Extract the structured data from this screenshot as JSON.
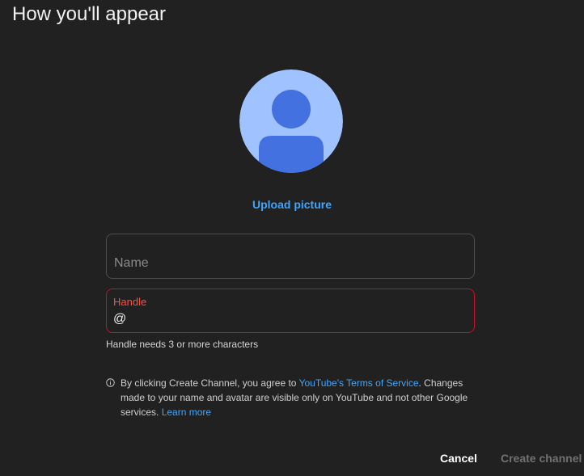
{
  "dialog": {
    "title": "How you'll appear"
  },
  "avatar": {
    "icon": "default-person-avatar",
    "upload_label": "Upload picture"
  },
  "name_field": {
    "placeholder": "Name",
    "value": ""
  },
  "handle_field": {
    "label": "Handle",
    "prefix": "@",
    "value": "",
    "error": "Handle needs 3 or more characters"
  },
  "notice": {
    "icon": "info-icon",
    "text_before": "By clicking Create Channel, you agree to ",
    "tos_link": "YouTube's Terms of Service",
    "text_middle": ". Changes made to your name and avatar are visible only on YouTube and not other Google services. ",
    "learn_more_link": "Learn more"
  },
  "actions": {
    "cancel_label": "Cancel",
    "create_label": "Create channel"
  },
  "colors": {
    "background": "#212121",
    "link": "#3ea6ff",
    "error": "#ff4e45",
    "avatar_bg": "#a0c3ff",
    "avatar_figure": "#4372e0"
  }
}
